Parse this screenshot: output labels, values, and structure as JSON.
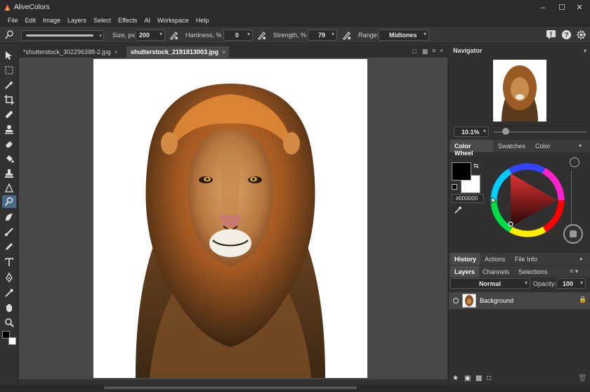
{
  "app": {
    "title": "AliveColors"
  },
  "menu": [
    "File",
    "Edit",
    "Image",
    "Layers",
    "Select",
    "Effects",
    "AI",
    "Workspace",
    "Help"
  ],
  "options": {
    "size_label": "Size, px",
    "size_value": "200",
    "hardness_label": "Hardness, %",
    "hardness_value": "0",
    "strength_label": "Strength, %",
    "strength_value": "79",
    "range_label": "Range:",
    "range_value": "Midtones"
  },
  "tabs": [
    {
      "label": "*shutterstock_302296388-2.jpg"
    },
    {
      "label": "shutterstock_2191813003.jpg"
    }
  ],
  "navigator": {
    "title": "Navigator",
    "zoom": "10.1%"
  },
  "color": {
    "tabs": [
      "Color Wheel",
      "Swatches",
      "Color"
    ],
    "hex": "#000000",
    "foreground": "#000000",
    "background": "#ffffff"
  },
  "history_tabs": [
    "History",
    "Actions",
    "File Info"
  ],
  "layers": {
    "tabs": [
      "Layers",
      "Channels",
      "Selections"
    ],
    "blend_mode": "Normal",
    "opacity_label": "Opacity:",
    "opacity_value": "100",
    "items": [
      {
        "name": "Background"
      }
    ]
  },
  "colors": {
    "accent": "#e23333",
    "panel": "#303030",
    "canvas": "#484848"
  }
}
